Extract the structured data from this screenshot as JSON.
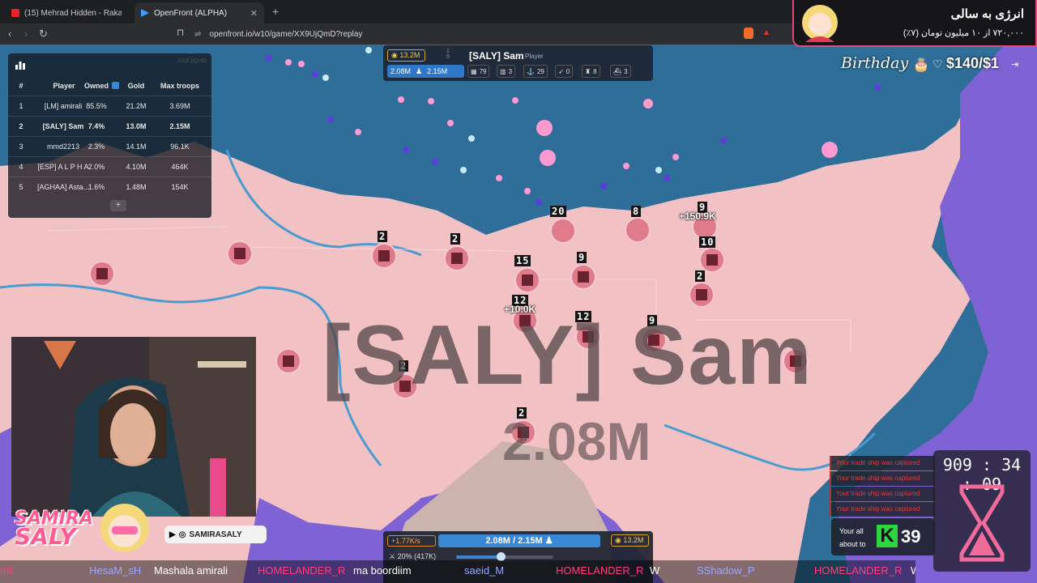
{
  "browser": {
    "tabs": [
      {
        "title": "(15) Mehrad Hidden - Rakab (Of",
        "active": false,
        "favicon_color": "#ff0000"
      },
      {
        "title": "OpenFront (ALPHA)",
        "active": true,
        "favicon_color": "#3aa0ff"
      }
    ],
    "url": "openfront.io/w10/game/XX9UjQmD?replay",
    "icons": [
      "back-icon",
      "forward-icon",
      "reload-icon",
      "bookmark-icon",
      "new-tab-icon"
    ]
  },
  "leaderboard": {
    "game_id": "XX9UjQmD",
    "headers": [
      "#",
      "Player",
      "Owned",
      "Gold",
      "Max troops"
    ],
    "rows": [
      {
        "rank": "1",
        "player": "[LM] amirali",
        "owned": "85.5%",
        "gold": "21.2M",
        "max_troops": "3.69M",
        "bold": false
      },
      {
        "rank": "2",
        "player": "[SALY] Sam",
        "owned": "7.4%",
        "gold": "13.0M",
        "max_troops": "2.15M",
        "bold": true
      },
      {
        "rank": "3",
        "player": "mmd2213",
        "owned": "2.3%",
        "gold": "14.1M",
        "max_troops": "96.1K",
        "bold": false
      },
      {
        "rank": "4",
        "player": "[ESP] A L P H A",
        "owned": "2.0%",
        "gold": "4.10M",
        "max_troops": "464K",
        "bold": false
      },
      {
        "rank": "5",
        "player": "[AGHAA] Asta...",
        "owned": "1.6%",
        "gold": "1.48M",
        "max_troops": "154K",
        "bold": false
      }
    ],
    "expand_label": "+"
  },
  "player_panel": {
    "gold": "13.2M",
    "score_top": "1",
    "score_bottom": "0",
    "name": "[SALY] Sam",
    "type": "Player",
    "troops": "2.08M",
    "max_troops": "2.15M",
    "stats": [
      {
        "icon": "building-icon",
        "value": "79"
      },
      {
        "icon": "city-icon",
        "value": "3"
      },
      {
        "icon": "port-icon",
        "value": "29"
      },
      {
        "icon": "missile-icon",
        "value": "0"
      },
      {
        "icon": "factory-icon",
        "value": "8"
      },
      {
        "icon": "warship-icon",
        "value": "3"
      }
    ]
  },
  "map": {
    "territory_name": "[SALY] Sam",
    "territory_troops": "2.08M",
    "city_levels": [
      "2",
      "2",
      "15",
      "9",
      "20",
      "8",
      "9",
      "10",
      "2",
      "12",
      "12",
      "9",
      "2",
      "2"
    ],
    "float_texts": [
      "+150.9K",
      "+10.0K"
    ],
    "colors": {
      "ocean": "#2f6f9a",
      "land_own": "#f2c1c4",
      "border": "#4a9bd0",
      "enemy": "#7b5fd0"
    }
  },
  "overlays": {
    "donation_title": "انرژی به سالی",
    "donation_sub": "۷۲۰,۰۰۰ از ۱۰ میلیون تومان (۷٪)",
    "birthday_label": "Birthday",
    "birthday_amount": "$140/$1"
  },
  "stream": {
    "brand_line1": "SAMIRA",
    "brand_line2": "SALY",
    "social_handle": "SAMIRASALY"
  },
  "controls": {
    "rate": "+1.77K/s",
    "troops_bar": "2.08M / 2.15M",
    "gold": "13.2M",
    "ratio": "20% (417K)",
    "slider_fraction": 0.45
  },
  "chat": [
    {
      "user": "HesaM_sH",
      "message": ""
    },
    {
      "user": "",
      "message": "Mashala amirali"
    },
    {
      "user": "HOMELANDER_R",
      "message": "ma boordiim"
    },
    {
      "user": "saeid_M",
      "message": ""
    },
    {
      "user": "HOMELANDER_R",
      "message": "W"
    },
    {
      "user": "SShadow_P",
      "message": ""
    },
    {
      "user": "HOMELANDER_R",
      "message": "W"
    }
  ],
  "notifications": [
    "Your trade ship was captured",
    "Your trade ship was captured",
    "Your trade ship was captured",
    "Your trade ship was captured"
  ],
  "timer": "909 : 34 : 09",
  "kick": {
    "label1": "Your all",
    "label2": "about to",
    "count": "39",
    "letter": "K"
  }
}
